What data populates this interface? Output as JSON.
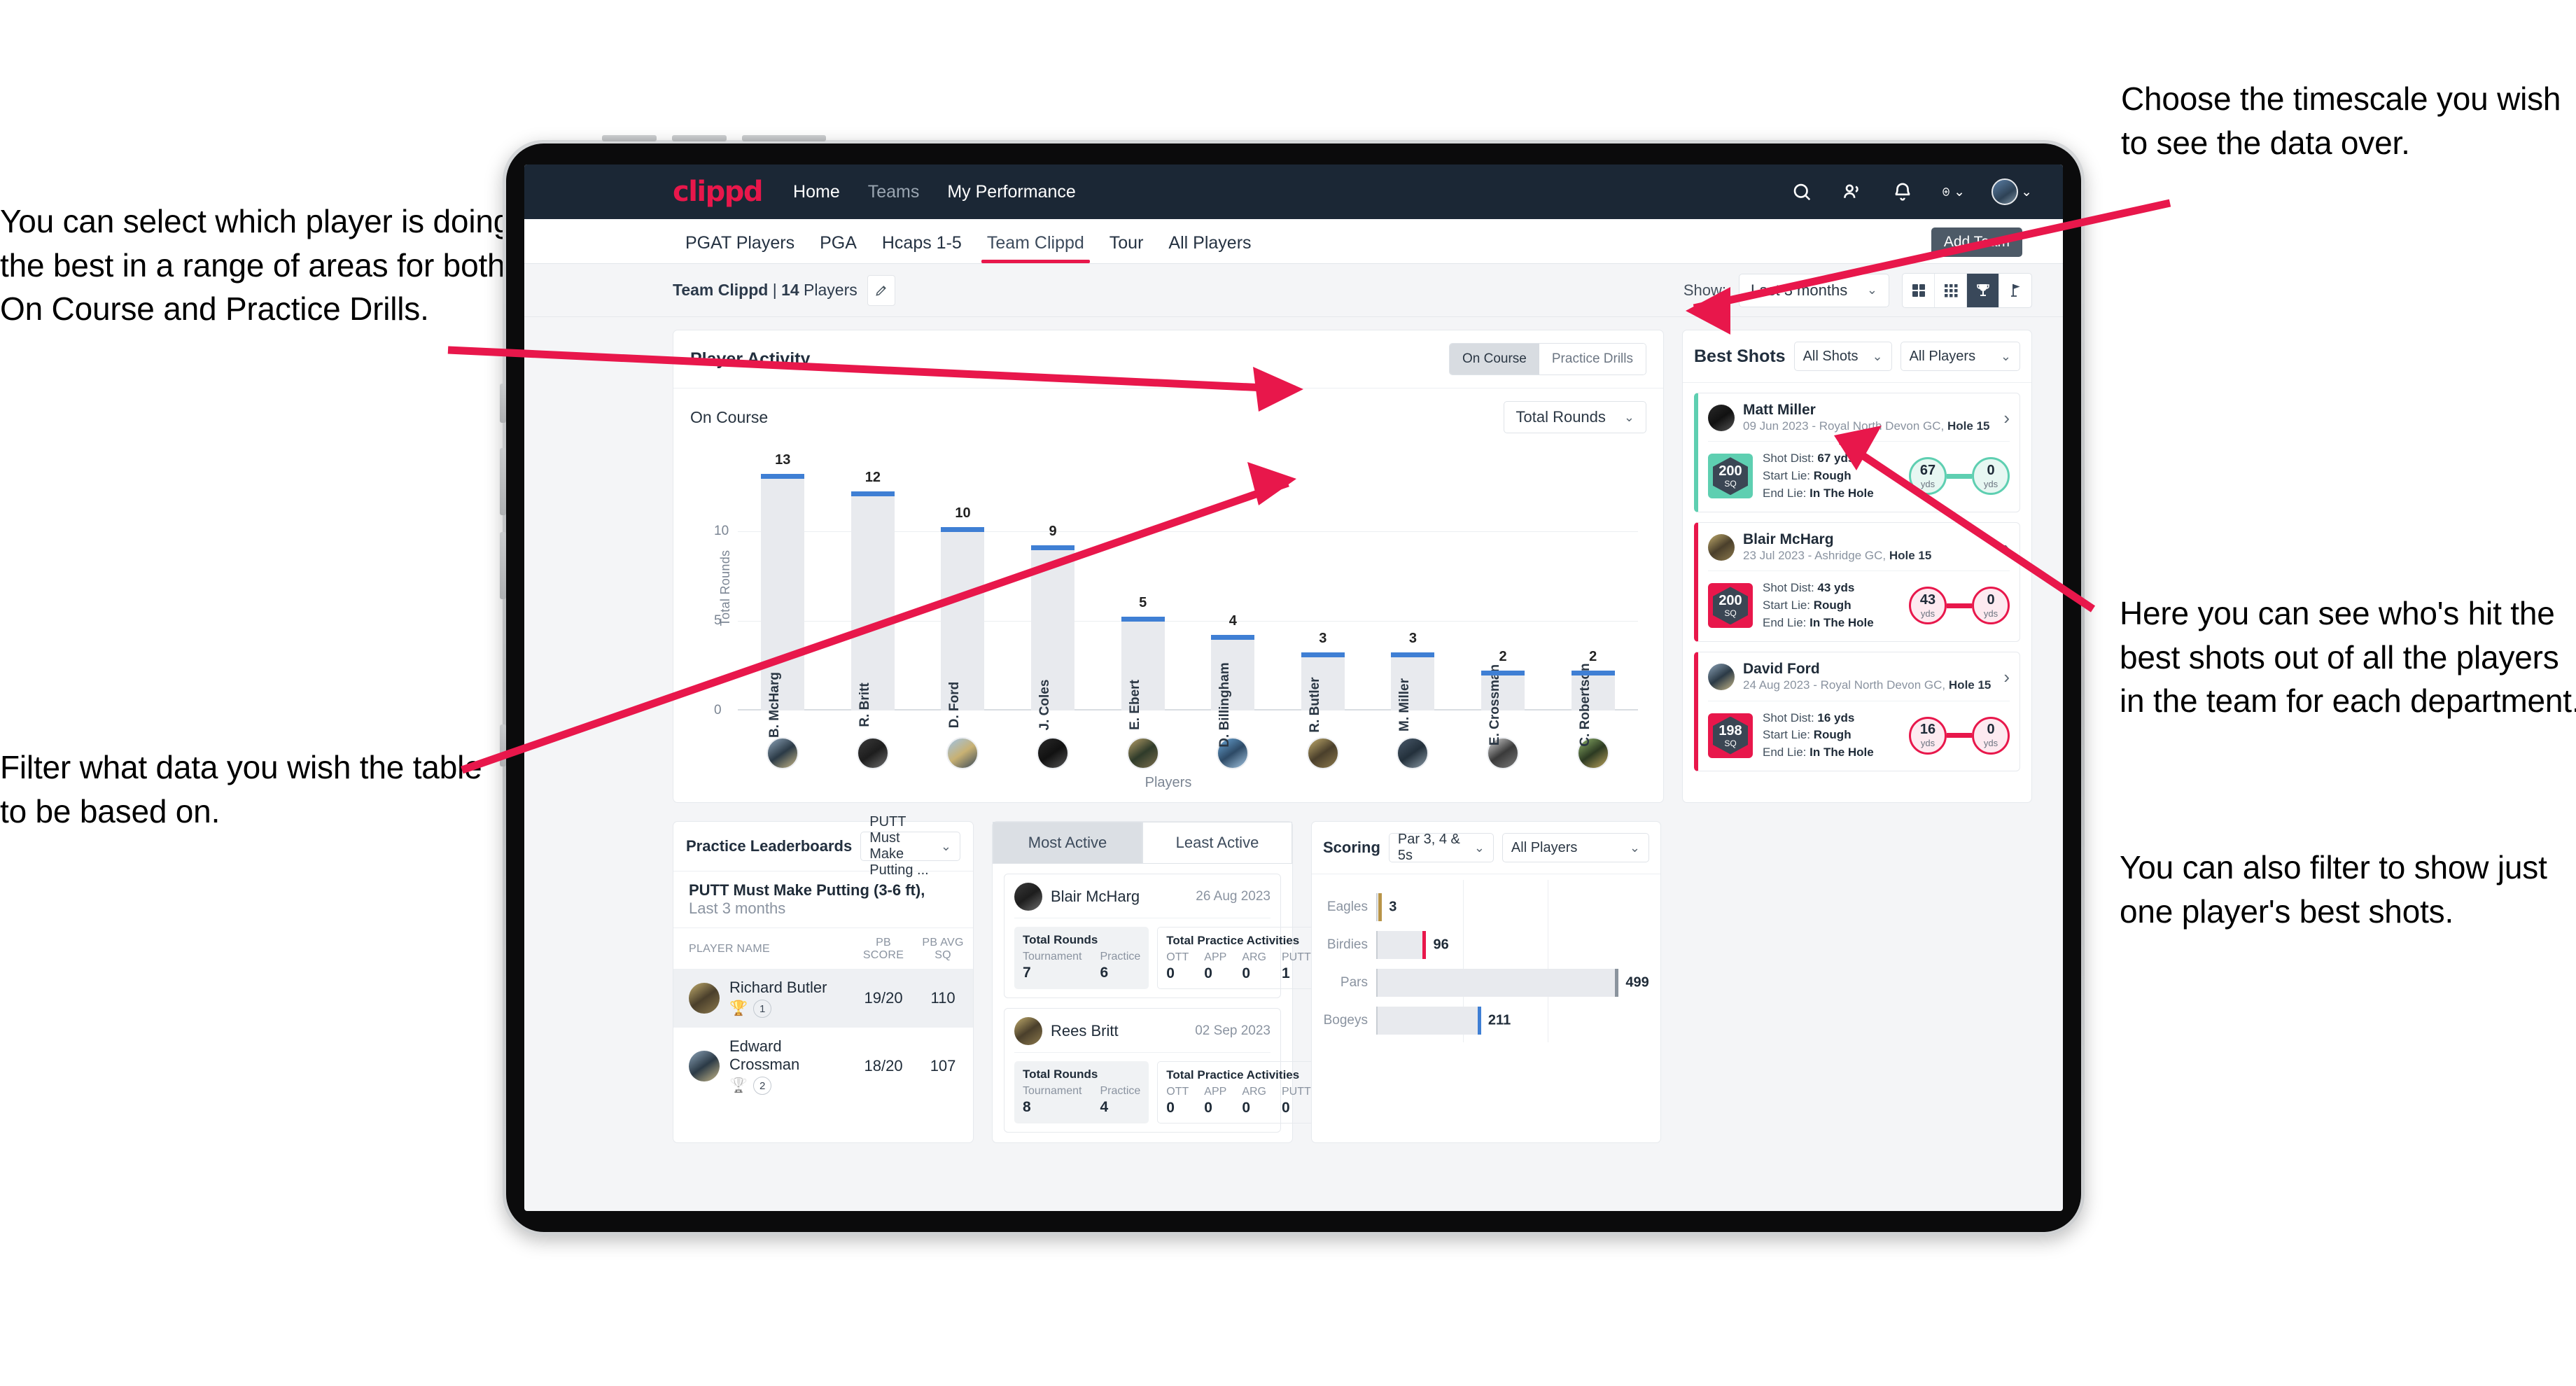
{
  "annotations": {
    "select_player": "You can select which player is doing the best in a range of areas for both On Course and Practice Drills.",
    "filter_data": "Filter what data you wish the table to be based on.",
    "timescale": "Choose the timescale you wish to see the data over.",
    "best_shots": "Here you can see who's hit the best shots out of all the players in the team for each department.",
    "filter_one_player": "You can also filter to show just one player's best shots."
  },
  "navbar": {
    "brand": "clippd",
    "links": [
      {
        "label": "Home",
        "active": true
      },
      {
        "label": "Teams",
        "active": false
      },
      {
        "label": "My Performance",
        "active": true
      }
    ],
    "icons": [
      "search-icon",
      "people-icon",
      "bell-icon",
      "plus-circle-icon",
      "avatar"
    ]
  },
  "tabs": [
    {
      "label": "PGAT Players",
      "active": false
    },
    {
      "label": "PGA",
      "active": false
    },
    {
      "label": "Hcaps 1-5",
      "active": false
    },
    {
      "label": "Team Clippd",
      "active": true
    },
    {
      "label": "Tour",
      "active": false
    },
    {
      "label": "All Players",
      "active": false
    }
  ],
  "tooltip": {
    "add_team": "Add Team"
  },
  "filterbar": {
    "team_name": "Team Clippd",
    "separator": " | ",
    "player_count": "14",
    "players_word": " Players",
    "show_label": "Show:",
    "timescale_value": "Last 3 months",
    "view_modes": [
      "grid-large-icon",
      "grid-small-icon",
      "trophy-icon",
      "flagstick-icon"
    ],
    "view_selected_index": 2
  },
  "player_activity": {
    "title": "Player Activity",
    "segment": {
      "options": [
        "On Course",
        "Practice Drills"
      ],
      "selected": "On Course"
    },
    "subtitle": "On Course",
    "metric_select": "Total Rounds",
    "x_axis_label": "Players"
  },
  "chart_data": {
    "type": "bar",
    "title": "Player Activity",
    "xlabel": "Players",
    "ylabel": "Total Rounds",
    "ylim": [
      0,
      14
    ],
    "yticks": [
      0,
      5,
      10
    ],
    "grid": true,
    "categories": [
      "B. McHarg",
      "R. Britt",
      "D. Ford",
      "J. Coles",
      "E. Ebert",
      "D. Billingham",
      "R. Butler",
      "M. Miller",
      "E. Crossman",
      "C. Robertson"
    ],
    "values": [
      13,
      12,
      10,
      9,
      5,
      4,
      3,
      3,
      2,
      2
    ],
    "bar_color": "#e8eaee",
    "cap_color": "#3f7fd4"
  },
  "best_shots": {
    "title": "Best Shots",
    "shot_filter": "All Shots",
    "player_filter": "All Players",
    "items": [
      {
        "player": "Matt Miller",
        "meta_date": "09 Jun 2023",
        "meta_course": "Royal North Devon GC,",
        "meta_hole": "Hole 15",
        "badge_value": "200",
        "badge_unit": "SQ",
        "shot_dist_label": "Shot Dist: ",
        "shot_dist": "67 yds",
        "start_lie_label": "Start Lie: ",
        "start_lie": "Rough",
        "end_lie_label": "End Lie: ",
        "end_lie": "In The Hole",
        "from_value": "67",
        "from_unit": "yds",
        "to_value": "0",
        "to_unit": "yds",
        "accent": "#5ecfb1"
      },
      {
        "player": "Blair McHarg",
        "meta_date": "23 Jul 2023",
        "meta_course": "Ashridge GC,",
        "meta_hole": "Hole 15",
        "badge_value": "200",
        "badge_unit": "SQ",
        "shot_dist_label": "Shot Dist: ",
        "shot_dist": "43 yds",
        "start_lie_label": "Start Lie: ",
        "start_lie": "Rough",
        "end_lie_label": "End Lie: ",
        "end_lie": "In The Hole",
        "from_value": "43",
        "from_unit": "yds",
        "to_value": "0",
        "to_unit": "yds",
        "accent": "#e8174b"
      },
      {
        "player": "David Ford",
        "meta_date": "24 Aug 2023",
        "meta_course": "Royal North Devon GC,",
        "meta_hole": "Hole 15",
        "badge_value": "198",
        "badge_unit": "SQ",
        "shot_dist_label": "Shot Dist: ",
        "shot_dist": "16 yds",
        "start_lie_label": "Start Lie: ",
        "start_lie": "Rough",
        "end_lie_label": "End Lie: ",
        "end_lie": "In The Hole",
        "from_value": "16",
        "from_unit": "yds",
        "to_value": "0",
        "to_unit": "yds",
        "accent": "#e8174b"
      }
    ]
  },
  "practice_leaderboards": {
    "title": "Practice Leaderboards",
    "drill_select": "PUTT Must Make Putting ...",
    "subtitle_bold": "PUTT Must Make Putting (3-6 ft),",
    "subtitle_light": " Last 3 months",
    "columns": [
      "PLAYER NAME",
      "PB SCORE",
      "PB AVG SQ"
    ],
    "rows": [
      {
        "name": "Richard Butler",
        "rank": "1",
        "trophy": "gold",
        "pb_score": "19/20",
        "pb_avg_sq": "110",
        "highlight": true
      },
      {
        "name": "Edward Crossman",
        "rank": "2",
        "trophy": "silver",
        "pb_score": "18/20",
        "pb_avg_sq": "107",
        "highlight": false
      }
    ]
  },
  "activity_panel": {
    "tabs": [
      {
        "label": "Most Active",
        "active": true
      },
      {
        "label": "Least Active",
        "active": false
      }
    ],
    "rounds_title": "Total Rounds",
    "rounds_keys": [
      "Tournament",
      "Practice"
    ],
    "practice_title": "Total Practice Activities",
    "practice_keys": [
      "OTT",
      "APP",
      "ARG",
      "PUTT"
    ],
    "items": [
      {
        "name": "Blair McHarg",
        "date": "26 Aug 2023",
        "rounds": [
          "7",
          "6"
        ],
        "practice": [
          "0",
          "0",
          "0",
          "1"
        ]
      },
      {
        "name": "Rees Britt",
        "date": "02 Sep 2023",
        "rounds": [
          "8",
          "4"
        ],
        "practice": [
          "0",
          "0",
          "0",
          "0"
        ]
      }
    ]
  },
  "scoring": {
    "title": "Scoring",
    "par_select": "Par 3, 4 & 5s",
    "player_select": "All Players"
  },
  "scoring_chart": {
    "type": "bar",
    "orientation": "horizontal",
    "title": "Scoring",
    "categories": [
      "Eagles",
      "Birdies",
      "Pars",
      "Bogeys"
    ],
    "values": [
      3,
      96,
      499,
      211
    ],
    "cap_colors": [
      "#b89448",
      "#e8174b",
      "#8b949e",
      "#3f7fd4"
    ],
    "xlim": [
      0,
      560
    ],
    "grid": true
  }
}
